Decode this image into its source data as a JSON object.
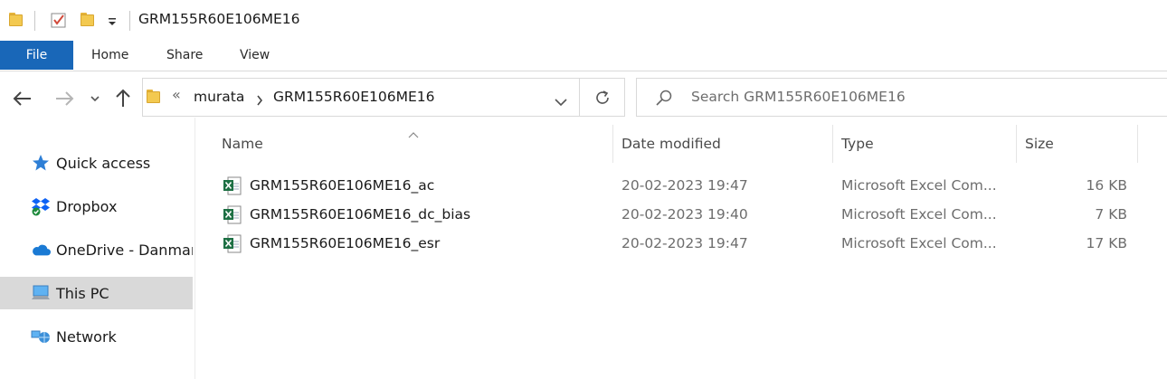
{
  "window": {
    "title": "GRM155R60E106ME16"
  },
  "ribbon": {
    "tabs": [
      "File",
      "Home",
      "Share",
      "View"
    ]
  },
  "address": {
    "overflow": "«",
    "crumbs": [
      "murata",
      "GRM155R60E106ME16"
    ]
  },
  "search": {
    "placeholder": "Search GRM155R60E106ME16"
  },
  "sidebar": {
    "items": [
      {
        "label": "Quick access",
        "icon": "star-icon"
      },
      {
        "label": "Dropbox",
        "icon": "dropbox-icon"
      },
      {
        "label": "OneDrive - Danmar",
        "icon": "onedrive-icon"
      },
      {
        "label": "This PC",
        "icon": "computer-icon",
        "selected": true
      },
      {
        "label": "Network",
        "icon": "network-icon"
      }
    ]
  },
  "columns": {
    "name": "Name",
    "date": "Date modified",
    "type": "Type",
    "size": "Size"
  },
  "files": [
    {
      "name": "GRM155R60E106ME16_ac",
      "date": "20-02-2023 19:47",
      "type": "Microsoft Excel Com...",
      "size": "16 KB"
    },
    {
      "name": "GRM155R60E106ME16_dc_bias",
      "date": "20-02-2023 19:40",
      "type": "Microsoft Excel Com...",
      "size": "7 KB"
    },
    {
      "name": "GRM155R60E106ME16_esr",
      "date": "20-02-2023 19:47",
      "type": "Microsoft Excel Com...",
      "size": "17 KB"
    }
  ],
  "colors": {
    "file_tab": "#1967b8",
    "selected_bg": "#d9d9d9",
    "excel_green": "#1d7044"
  }
}
